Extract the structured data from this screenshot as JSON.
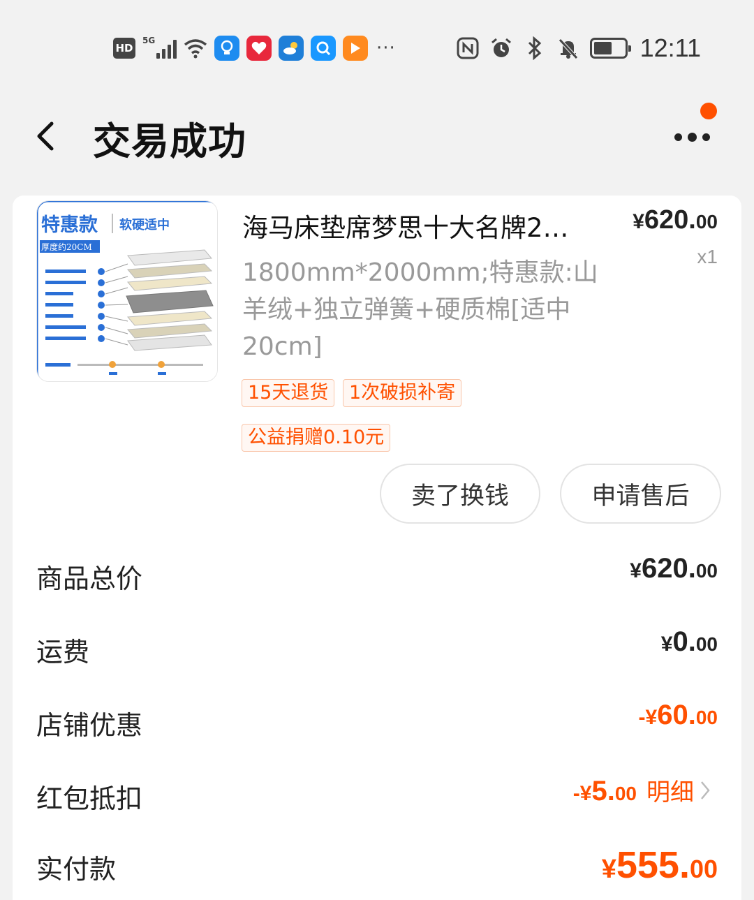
{
  "status_bar": {
    "hd": "HD",
    "network": "5G",
    "time": "12:11",
    "more": "···"
  },
  "header": {
    "title": "交易成功"
  },
  "product": {
    "title": "海马床垫席梦思十大名牌2…",
    "price_yen": "¥",
    "price_int": "620.",
    "price_dec": "00",
    "qty": "x1",
    "sku": "1800mm*2000mm;特惠款:山羊绒+独立弹簧+硬质棉[适中20cm]",
    "tags": [
      "15天退货",
      "1次破损补寄",
      "公益捐赠0.10元"
    ],
    "image_text": {
      "badge": "特惠款",
      "subtitle": "软硬适中",
      "thickness": "厚度约20CM"
    }
  },
  "actions": {
    "sell": "卖了换钱",
    "after_sale": "申请售后"
  },
  "summary": {
    "goods_total": {
      "label": "商品总价",
      "prefix": "",
      "yen": "¥",
      "int": "620.",
      "dec": "00"
    },
    "shipping": {
      "label": "运费",
      "prefix": "",
      "yen": "¥",
      "int": "0.",
      "dec": "00"
    },
    "store_discount": {
      "label": "店铺优惠",
      "prefix": "-",
      "yen": "¥",
      "int": "60.",
      "dec": "00"
    },
    "red_packet": {
      "label": "红包抵扣",
      "prefix": "-",
      "yen": "¥",
      "int": "5.",
      "dec": "00",
      "link": "明细"
    },
    "paid": {
      "label": "实付款",
      "yen": "¥",
      "int": "555.",
      "dec": "00"
    }
  },
  "colors": {
    "accent": "#ff5000",
    "background": "#f2f2f2"
  }
}
